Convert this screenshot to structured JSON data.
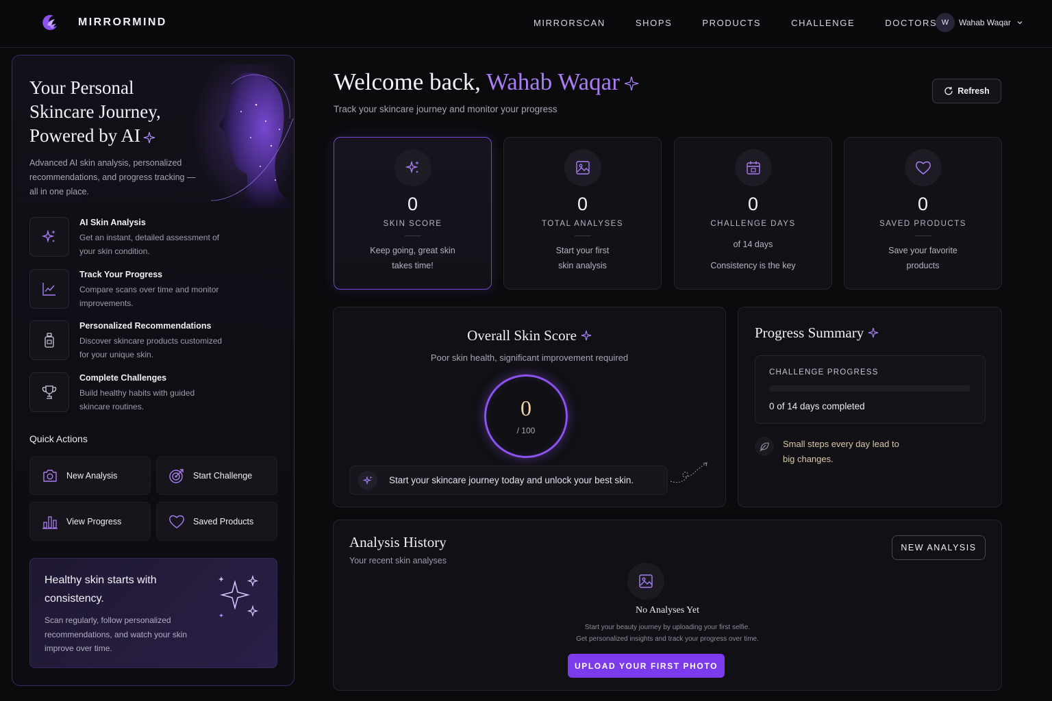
{
  "brand": {
    "name": "MIRRORMIND"
  },
  "nav": {
    "links": [
      "MIRRORSCAN",
      "SHOPS",
      "PRODUCTS",
      "CHALLENGE",
      "DOCTORS"
    ],
    "user": {
      "initial": "W",
      "name": "Wahab Waqar"
    }
  },
  "sidebar": {
    "title": "Your Personal Skincare Journey, Powered by AI",
    "description": "Advanced AI skin analysis, personalized recommendations, and progress tracking — all in one place.",
    "features": [
      {
        "icon": "sparkles-icon",
        "title": "AI Skin Analysis",
        "desc": "Get an instant, detailed assessment of your skin condition."
      },
      {
        "icon": "chart-line-icon",
        "title": "Track Your Progress",
        "desc": "Compare scans over time and monitor improvements."
      },
      {
        "icon": "bottle-icon",
        "title": "Personalized Recommendations",
        "desc": "Discover skincare products customized for your unique skin."
      },
      {
        "icon": "trophy-icon",
        "title": "Complete Challenges",
        "desc": "Build healthy habits with guided skincare routines."
      }
    ],
    "quick_actions_title": "Quick Actions",
    "quick_actions": [
      {
        "icon": "camera-icon",
        "label": "New Analysis"
      },
      {
        "icon": "target-icon",
        "label": "Start Challenge"
      },
      {
        "icon": "bar-chart-icon",
        "label": "View Progress"
      },
      {
        "icon": "heart-icon",
        "label": "Saved Products"
      }
    ],
    "tip": {
      "title": "Healthy skin starts with consistency.",
      "desc": "Scan regularly, follow personalized recommendations, and watch your skin improve over time."
    }
  },
  "header": {
    "welcome_prefix": "Welcome back,",
    "welcome_name": "Wahab Waqar",
    "subtitle": "Track your skincare journey and monitor your progress",
    "refresh_label": "Refresh"
  },
  "stats": [
    {
      "icon": "sparkles-icon",
      "value": "0",
      "label": "SKIN SCORE",
      "desc1": "Keep going, great skin",
      "desc2": "takes time!"
    },
    {
      "icon": "image-icon",
      "value": "0",
      "label": "TOTAL ANALYSES",
      "desc1": "Start your first",
      "desc2": "skin analysis"
    },
    {
      "icon": "calendar-icon",
      "value": "0",
      "label": "CHALLENGE DAYS",
      "desc1": "of 14 days",
      "desc2": "Consistency is the key"
    },
    {
      "icon": "heart-icon",
      "value": "0",
      "label": "SAVED PRODUCTS",
      "desc1": "Save your favorite",
      "desc2": "products"
    }
  ],
  "overall_score": {
    "title": "Overall Skin Score",
    "subtitle": "Poor skin health, significant improvement required",
    "value": "0",
    "out_of": "/ 100",
    "journey_text": "Start your skincare journey today and unlock your best skin."
  },
  "progress_summary": {
    "title": "Progress Summary",
    "challenge_label": "CHALLENGE PROGRESS",
    "progress_fraction": 0,
    "days_text": "0 of 14 days completed",
    "note": "Small steps every day lead to big changes."
  },
  "analysis_history": {
    "title": "Analysis History",
    "subtitle": "Your recent skin analyses",
    "new_button": "NEW ANALYSIS",
    "empty_title": "No Analyses Yet",
    "empty_line1": "Start your beauty journey by uploading your first selfie.",
    "empty_line2": "Get personalized insights and track your progress over time.",
    "upload_button": "UPLOAD YOUR FIRST PHOTO"
  },
  "colors": {
    "accent": "#8a52ee",
    "accent_text": "#a97ef5",
    "background": "#0b0b0d",
    "score_value": "#f0d2a6"
  }
}
